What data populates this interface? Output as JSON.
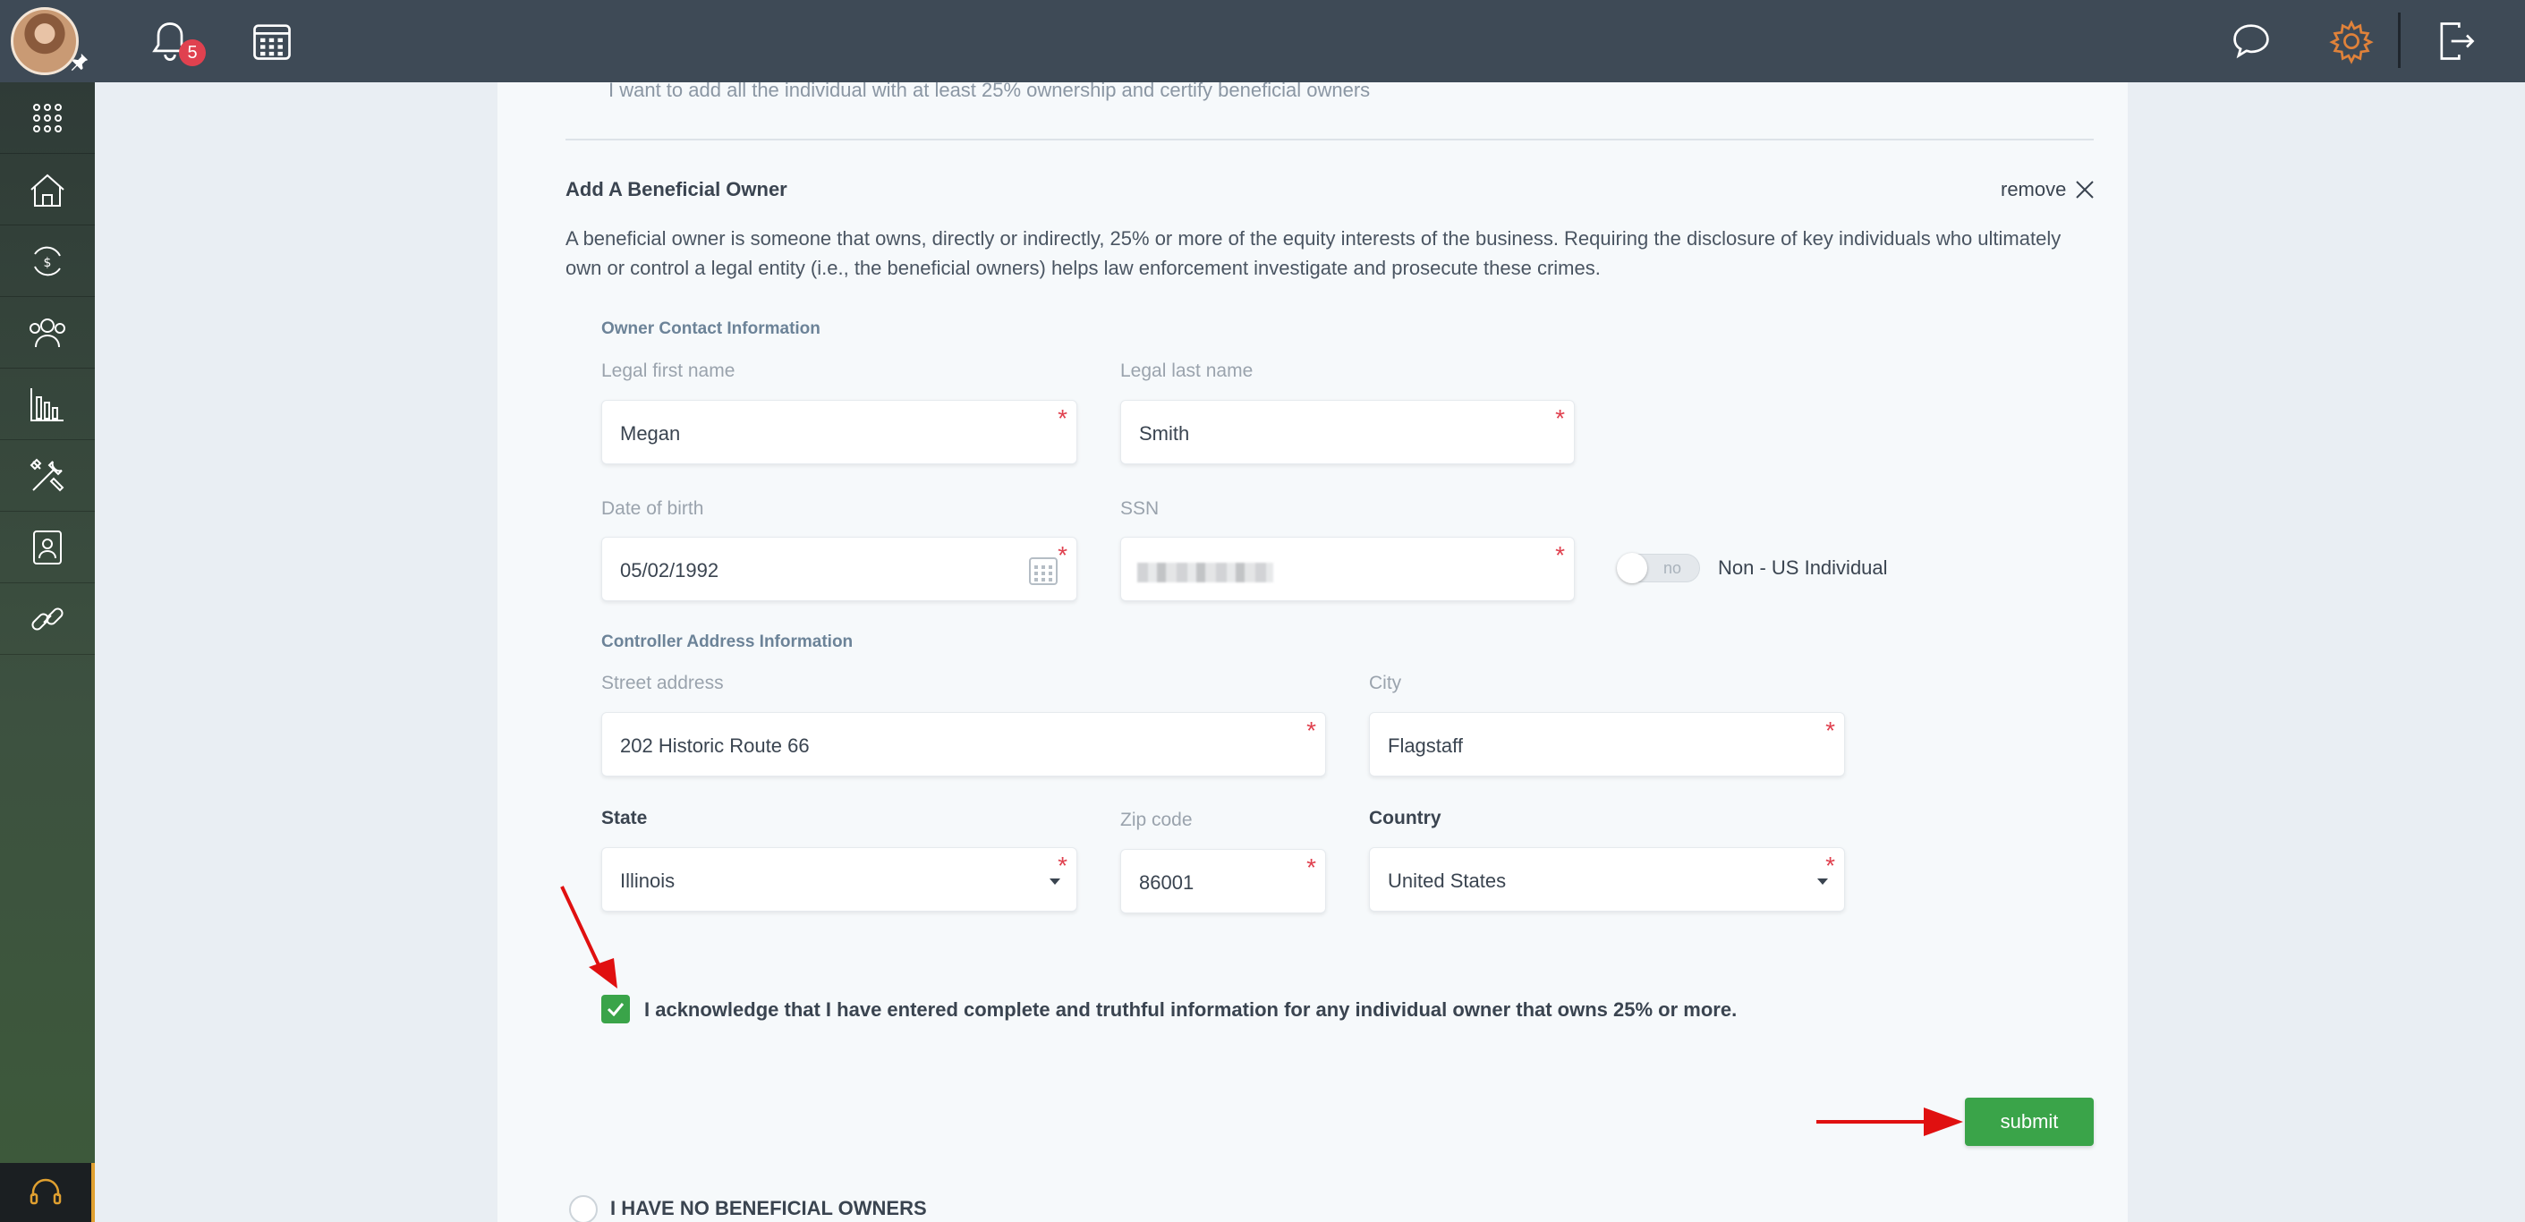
{
  "topbar": {
    "notification_count": "5",
    "icons": [
      "bell-icon",
      "calendar-icon",
      "chat-icon",
      "gear-icon",
      "logout-icon"
    ]
  },
  "sidebar": {
    "items": [
      "apps-grid-icon",
      "home-icon",
      "transfer-icon",
      "users-icon",
      "reports-icon",
      "tools-icon",
      "contact-card-icon",
      "link-icon"
    ],
    "bottom": "support-headset-icon"
  },
  "form": {
    "top_text": "I want to add all the individual with at least 25% ownership and certify beneficial owners",
    "title": "Add A Beneficial Owner",
    "remove_label": "remove",
    "description": "A beneficial owner is someone that owns, directly or indirectly, 25% or more of the equity interests of the business. Requiring the disclosure of key individuals who ultimately own or control a legal entity (i.e., the beneficial owners) helps law enforcement investigate and prosecute these crimes.",
    "owner_section": "Owner Contact Information",
    "first_name_label": "Legal first name",
    "first_name": "Megan",
    "last_name_label": "Legal last name",
    "last_name": "Smith",
    "dob_label": "Date of birth",
    "dob": "05/02/1992",
    "ssn_label": "SSN",
    "toggle_text": "no",
    "toggle_label": "Non - US Individual",
    "address_section": "Controller Address Information",
    "street_label": "Street address",
    "street": "202 Historic Route 66",
    "city_label": "City",
    "city": "Flagstaff",
    "state_label": "State",
    "state": "Illinois",
    "zip_label": "Zip code",
    "zip": "86001",
    "country_label": "Country",
    "country": "United States",
    "acknowledge": "I acknowledge that I have entered complete and truthful information for any individual owner that owns 25% or more.",
    "acknowledge_checked": true,
    "submit_label": "submit",
    "no_owners_label": "I HAVE NO BENEFICIAL OWNERS"
  },
  "colors": {
    "topbar": "#3e4a56",
    "accent_green": "#3aa449",
    "required": "#e0414f",
    "gear_active": "#e0823a",
    "arrow": "#e01010"
  }
}
